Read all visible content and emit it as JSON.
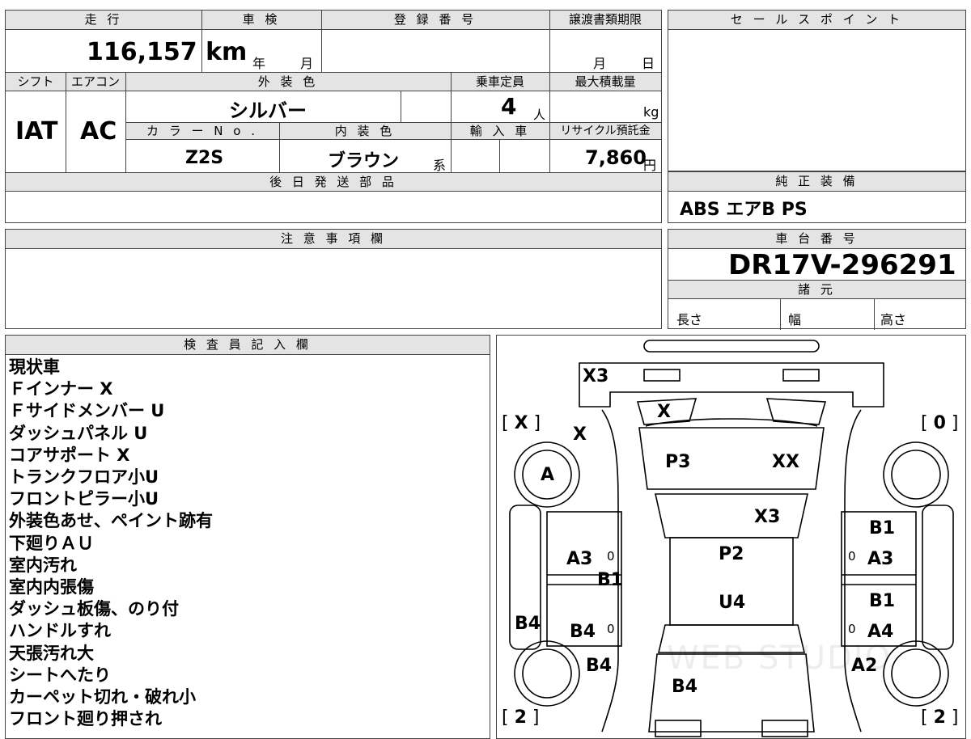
{
  "mileage": {
    "header": "走 行",
    "value": "116,157 km"
  },
  "inspection": {
    "header": "車 検",
    "year_unit": "年",
    "month_unit": "月"
  },
  "registration": {
    "header": "登 録 番 号",
    "value": ""
  },
  "transfer_deadline": {
    "header": "譲渡書類期限",
    "month_unit": "月",
    "day_unit": "日"
  },
  "sales_point": {
    "header": "セ ー ル ス ポ イ ン ト",
    "value": ""
  },
  "shift": {
    "header": "シフト",
    "value": "IAT"
  },
  "aircon": {
    "header": "エアコン",
    "value": "AC"
  },
  "exterior_color": {
    "header": "外 装 色",
    "value": "シルバー"
  },
  "capacity": {
    "header": "乗車定員",
    "value": "4",
    "unit": "人"
  },
  "max_load": {
    "header": "最大積載量",
    "value": "",
    "unit": "kg"
  },
  "color_no": {
    "header": "カ ラ ー N o .",
    "value": "Z2S"
  },
  "interior_color": {
    "header": "内 装 色",
    "value": "ブラウン",
    "suffix": "系"
  },
  "import": {
    "header": "輸 入 車",
    "value": ""
  },
  "recycle": {
    "header": "リサイクル預託金",
    "value": "7,860",
    "unit": "円"
  },
  "later_parts": {
    "header": "後 日 発 送 部 品",
    "value": ""
  },
  "genuine_equipment": {
    "header": "純 正 装 備",
    "value": "ABS エアB PS"
  },
  "caution": {
    "header": "注 意 事 項 欄",
    "value": ""
  },
  "chassis": {
    "header": "車 台 番 号",
    "value": "DR17V-296291"
  },
  "specs": {
    "header": "諸 元",
    "length": "長さ",
    "width": "幅",
    "height": "高さ"
  },
  "inspector": {
    "header": "検 査 員 記 入 欄",
    "notes": [
      "現状車",
      "Ｆインナー X",
      "Ｆサイドメンバー U",
      "ダッシュパネル U",
      "コアサポート X",
      "トランクフロア小U",
      "フロントピラー小U",
      "外装色あせ、ペイント跡有",
      "下廻りＡＵ",
      "室内汚れ",
      "室内内張傷",
      "ダッシュ板傷、のり付",
      "ハンドルすれ",
      "天張汚れ大",
      "シートへたり",
      "カーペット切れ・破れ小",
      "フロント廻り押され"
    ]
  },
  "diagram": {
    "marks": {
      "front_bumper": "X3",
      "left_bracket": "X",
      "right_bracket": "0",
      "left_fender": "X",
      "grille": "X",
      "left_front_wheel": "A",
      "hood_left": "P3",
      "hood_right": "XX",
      "windshield": "X3",
      "right_front_door_top": "B1",
      "left_front_door": "A3",
      "roof_front": "P2",
      "left_pillar": "B1",
      "right_front_door": "A3",
      "right_rear_door_top": "B1",
      "roof_rear": "U4",
      "left_side_panel": "B4",
      "left_rear_door": "B4",
      "right_rear_door": "A4",
      "left_rear_quarter": "B4",
      "right_rear_quarter": "A2",
      "trunk": "B4",
      "left_rear_bracket": "2",
      "right_rear_bracket": "2",
      "zero": "0"
    },
    "watermark": "WEB STUDIO"
  }
}
